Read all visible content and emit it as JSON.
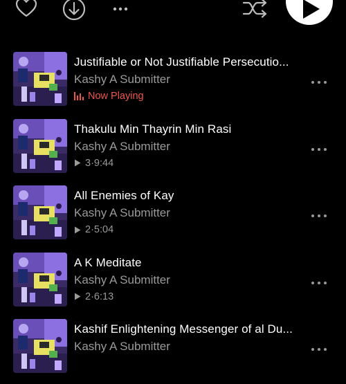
{
  "toolbar": {
    "favorite_icon": "heart-icon",
    "download_icon": "download-icon",
    "more_icon": "more-horizontal-icon",
    "shuffle_icon": "shuffle-icon",
    "play_icon": "play-icon"
  },
  "tracks": [
    {
      "title": "Justifiable or Not Justifiable Persecutio...",
      "artist": "Kashy A Submitter",
      "status": "Now Playing"
    },
    {
      "title": "Thakulu Min Thayrin Min Rasi",
      "artist": "Kashy A Submitter",
      "plays": "3",
      "duration": "9:44"
    },
    {
      "title": "All Enemies of Kay",
      "artist": "Kashy A Submitter",
      "plays": "2",
      "duration": "5:04"
    },
    {
      "title": "A K Meditate",
      "artist": "Kashy A Submitter",
      "plays": "2",
      "duration": "6:13"
    },
    {
      "title": "Kashif Enlightening Messenger of al Du...",
      "artist": "Kashy A Submitter"
    }
  ],
  "colors": {
    "background": "#000000",
    "now_playing": "#f0554b",
    "secondary_text": "#9a9a9a"
  }
}
